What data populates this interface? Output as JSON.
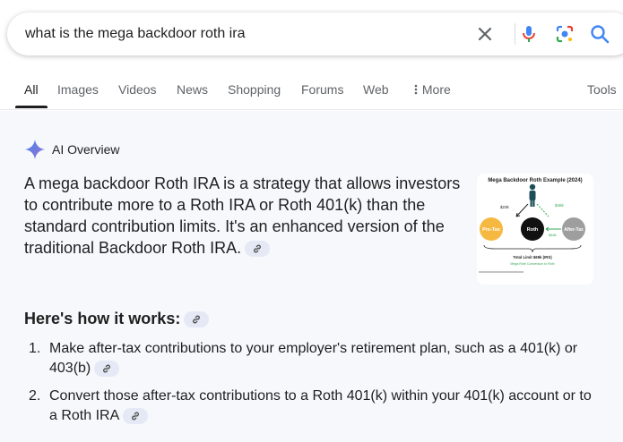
{
  "search": {
    "query": "what is the mega backdoor roth ira"
  },
  "icons": {
    "clear": "close-icon",
    "voice": "mic-icon",
    "lens": "lens-icon",
    "search": "search-icon",
    "sparkle": "gemini-sparkle-icon",
    "link": "link-icon",
    "more": "more-vert-icon"
  },
  "tabs": [
    {
      "label": "All",
      "active": true
    },
    {
      "label": "Images"
    },
    {
      "label": "Videos"
    },
    {
      "label": "News"
    },
    {
      "label": "Shopping"
    },
    {
      "label": "Forums"
    },
    {
      "label": "Web"
    },
    {
      "label": "More"
    }
  ],
  "tools_label": "Tools",
  "ai_overview": {
    "title": "AI Overview",
    "summary": "A mega backdoor Roth IRA is a strategy that allows investors to contribute more to a Roth IRA or Roth 401(k) than the standard contribution limits. It's an enhanced version of the traditional Backdoor Roth IRA.",
    "thumbnail": {
      "title": "Mega Backdoor Roth Example (2024)",
      "left_amount": "$23k",
      "right_amount": "$46k",
      "bottom_amount": "$46k",
      "pretax": "Pre-Tax",
      "roth": "Roth",
      "aftertax": "After-Tax",
      "total": "Total Limit $69k (IRS)",
      "note": "Mega Roth Conversion to Roth"
    },
    "how_title": "Here's how it works:",
    "steps": [
      {
        "num": "1.",
        "text": "Make after-tax contributions to your employer's retirement plan, such as a 401(k) or 403(b)"
      },
      {
        "num": "2.",
        "text": "Convert those after-tax contributions to a Roth 401(k) within your 401(k) account or to a Roth IRA"
      }
    ]
  },
  "colors": {
    "accent_blue": "#4285f4",
    "red": "#ea4335",
    "yellow": "#fbbc04",
    "green": "#34a853",
    "panel_bg": "#f7f8fc",
    "chip_bg": "#e4e9f5"
  }
}
